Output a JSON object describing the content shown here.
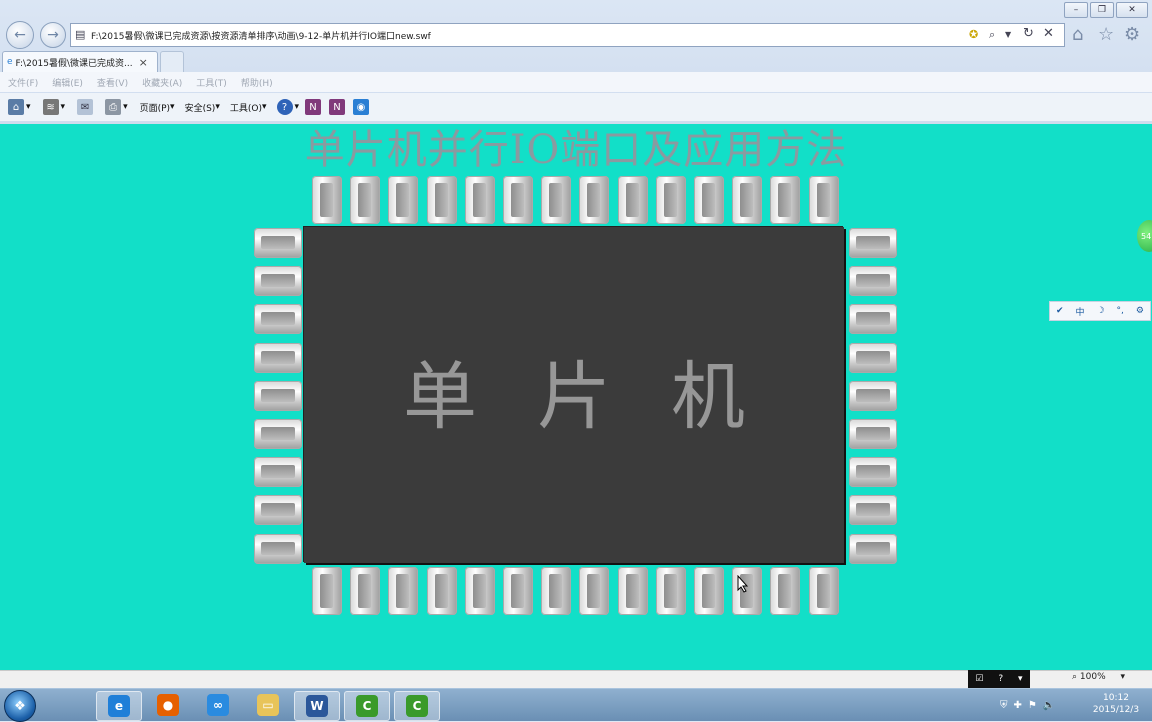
{
  "window": {
    "minimize_label": "–",
    "restore_label": "❐",
    "close_label": "✕"
  },
  "address_bar": {
    "url": "F:\\2015暑假\\微课已完成资源\\按资源清单排序\\动画\\9-12-单片机并行IO端口new.swf"
  },
  "tab": {
    "title": "F:\\2015暑假\\微课已完成资...",
    "close_label": "×"
  },
  "menu": {
    "items": [
      "文件(F)",
      "编辑(E)",
      "查看(V)",
      "收藏夹(A)",
      "工具(T)",
      "帮助(H)"
    ]
  },
  "command_bar": {
    "page_label": "页面(P)",
    "safety_label": "安全(S)",
    "tools_label": "工具(O)"
  },
  "content": {
    "title": "单片机并行IO端口及应用方法",
    "chip_label": "单片机",
    "top_pin_count": 14,
    "bottom_pin_count": 14,
    "left_pin_count": 9,
    "right_pin_count": 9,
    "background_color": "#12dfc8",
    "chip_color": "#3b3b3b"
  },
  "side_badge": {
    "text": "54"
  },
  "ime_bar": {
    "items": [
      "✔",
      "中",
      "☽",
      "°,",
      "⚙"
    ]
  },
  "status_bar": {
    "zoom": "100%"
  },
  "taskbar": {
    "apps": [
      {
        "name": "ie",
        "glyph": "e",
        "color": "#1f7fd8"
      },
      {
        "name": "firefox",
        "glyph": "●",
        "color": "#e66000"
      },
      {
        "name": "baidu-cloud",
        "glyph": "∞",
        "color": "#2a8be0"
      },
      {
        "name": "explorer",
        "glyph": "▭",
        "color": "#e8c45a"
      },
      {
        "name": "word",
        "glyph": "W",
        "color": "#2b579a"
      },
      {
        "name": "camtasia-1",
        "glyph": "C",
        "color": "#3a9a2a"
      },
      {
        "name": "camtasia-2",
        "glyph": "C",
        "color": "#3a9a2a"
      }
    ],
    "clock_time": "10:12",
    "clock_date": "2015/12/3"
  }
}
